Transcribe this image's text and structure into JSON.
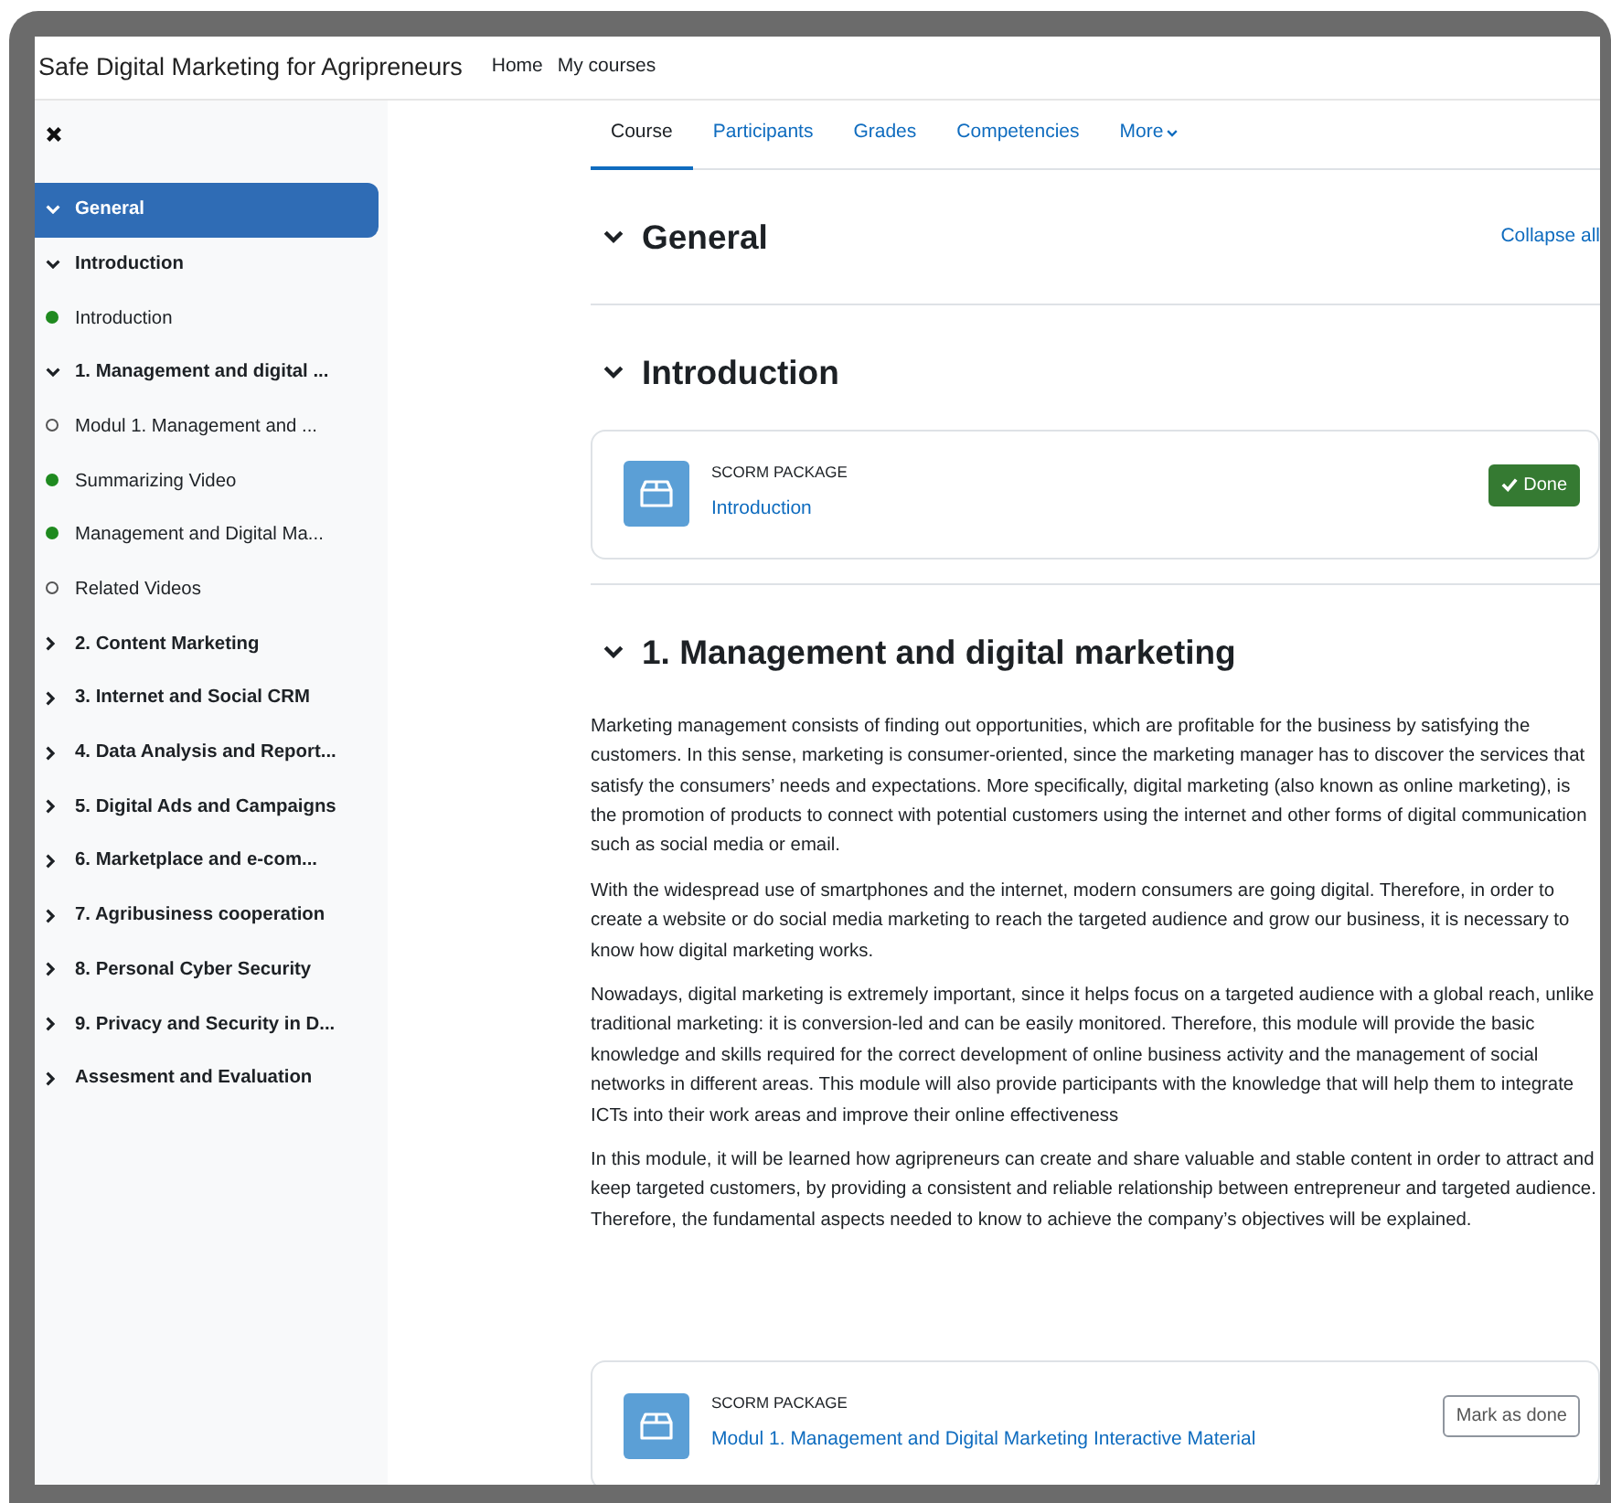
{
  "navbar": {
    "site_name": "Safe Digital Marketing for Agripreneurs",
    "links": [
      {
        "label": "Home"
      },
      {
        "label": "My courses"
      }
    ]
  },
  "sidebar": {
    "items": [
      {
        "kind": "section",
        "title": "General",
        "selected": true,
        "expanded": true
      },
      {
        "kind": "section",
        "title": "Introduction",
        "selected": false,
        "expanded": true,
        "children": [
          {
            "kind": "activity",
            "title": "Introduction",
            "selected": false,
            "completed": true
          }
        ]
      },
      {
        "kind": "section",
        "title": "1. Management and digital ...",
        "selected": false,
        "expanded": true,
        "children": [
          {
            "kind": "activity",
            "title": "Modul 1. Management and ...",
            "selected": false,
            "completed": false
          },
          {
            "kind": "activity",
            "title": "Summarizing Video",
            "selected": false,
            "completed": true
          },
          {
            "kind": "activity",
            "title": "Management and Digital Ma...",
            "selected": false,
            "completed": true
          },
          {
            "kind": "activity",
            "title": "Related Videos",
            "selected": false,
            "completed": false
          }
        ]
      },
      {
        "kind": "section",
        "title": "2. Content Marketing",
        "selected": false,
        "expanded": false
      },
      {
        "kind": "section",
        "title": "3. Internet and Social CRM",
        "selected": false,
        "expanded": false
      },
      {
        "kind": "section",
        "title": "4. Data Analysis and Report...",
        "selected": false,
        "expanded": false
      },
      {
        "kind": "section",
        "title": "5. Digital Ads and Campaigns",
        "selected": false,
        "expanded": false
      },
      {
        "kind": "section",
        "title": "6. Marketplace and e-com...",
        "selected": false,
        "expanded": false
      },
      {
        "kind": "section",
        "title": "7. Agribusiness cooperation",
        "selected": false,
        "expanded": false
      },
      {
        "kind": "section",
        "title": "8. Personal Cyber Security",
        "selected": false,
        "expanded": false
      },
      {
        "kind": "section",
        "title": "9. Privacy and Security in D...",
        "selected": false,
        "expanded": false
      },
      {
        "kind": "section",
        "title": "Assesment and Evaluation",
        "selected": false,
        "expanded": false
      }
    ]
  },
  "tabs": [
    {
      "label": "Course",
      "selected": true,
      "dropdown": false
    },
    {
      "label": "Participants",
      "selected": false,
      "dropdown": false
    },
    {
      "label": "Grades",
      "selected": false,
      "dropdown": false
    },
    {
      "label": "Competencies",
      "selected": false,
      "dropdown": false
    },
    {
      "label": "More",
      "selected": false,
      "dropdown": true
    }
  ],
  "collapse_all": "Collapse all",
  "sections": [
    {
      "title": "General",
      "expanded": true
    },
    {
      "title": "Introduction",
      "expanded": true,
      "activities": [
        {
          "type": "SCORM PACKAGE",
          "name": "Introduction",
          "completion": {
            "label": "Done",
            "done": true
          }
        }
      ]
    },
    {
      "title": "1. Management and digital marketing",
      "expanded": true,
      "summary": [
        "Marketing management consists of finding out opportunities, which are profitable for the business by satisfying the customers. In this sense, marketing is consumer-oriented, since the marketing manager has to discover the services that satisfy the consumers’ needs and expectations. More specifically, digital marketing (also known as online marketing), is the promotion of products to connect with potential customers using the internet and other forms of digital communication such as social media or email.",
        "With the widespread use of smartphones and the internet, modern consumers are going digital. Therefore, in order to create a website or do social media marketing to reach the targeted audience and grow our business, it is necessary to know how digital marketing works.",
        "Nowadays, digital marketing is extremely important, since it helps focus on a targeted audience with a global reach, unlike traditional marketing: it is conversion-led and can be easily monitored. Therefore, this module will provide the basic knowledge and skills required for the correct development of online business activity and the management of social networks in different areas. This module will also provide participants with the knowledge that will help them to integrate ICTs into their work areas and improve their online effectiveness",
        "In this module, it will be learned how agripreneurs can create and share valuable and stable content in order to attract and keep targeted customers, by providing a consistent and reliable relationship between entrepreneur and targeted audience. Therefore, the fundamental aspects needed to know to achieve the company’s objectives will be explained."
      ],
      "activities": [
        {
          "type": "SCORM PACKAGE",
          "name": "Modul 1. Management and Digital Marketing Interactive Material",
          "completion": {
            "label": "Mark as done",
            "done": false
          }
        }
      ]
    }
  ]
}
